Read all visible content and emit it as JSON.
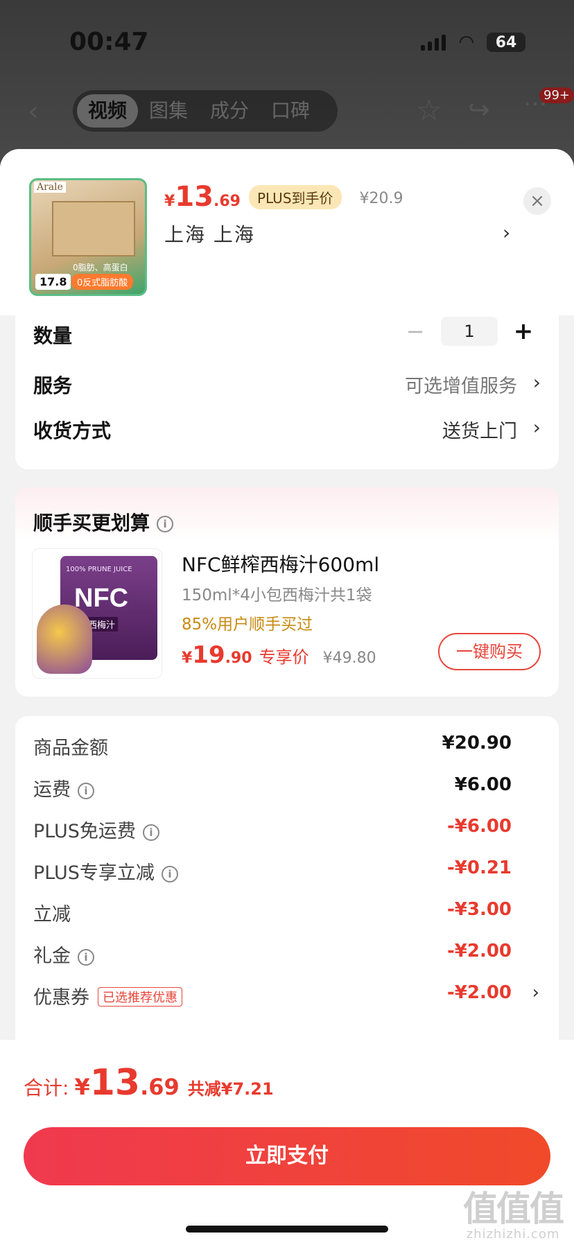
{
  "status_bar": {
    "time": "00:47",
    "battery": "64"
  },
  "nav": {
    "tabs": [
      {
        "label": "视频",
        "active": true
      },
      {
        "label": "图集",
        "active": false
      },
      {
        "label": "成分",
        "active": false
      },
      {
        "label": "口碑",
        "active": false
      }
    ],
    "badge": "99+"
  },
  "product": {
    "image_brand": "Arale",
    "image_price_tag": "17.8",
    "image_ribbon": "0反式脂肪酸",
    "image_subtag": "0脂肪、高蛋白",
    "price_symbol": "¥",
    "price_int": "13",
    "price_dec": ".69",
    "plus_tag": "PLUS到手价",
    "original_price": "¥20.9",
    "location": "上海  上海"
  },
  "options": {
    "quantity_label": "数量",
    "quantity_value": "1",
    "service_label": "服务",
    "service_value": "可选增值服务",
    "delivery_label": "收货方式",
    "delivery_value": "送货上门"
  },
  "addon": {
    "title": "顺手买更划算",
    "image_top_text": "100% PRUNE JUICE",
    "image_main_text": "NFC",
    "image_cn_text": "鲜榨西梅汁",
    "name": "NFC鲜榨西梅汁600ml",
    "spec": "150ml*4小包西梅汁共1袋",
    "rate": "85%用户顺手买过",
    "price_symbol": "¥",
    "price_int": "19",
    "price_dec": ".90",
    "price_label": "专享价",
    "original_price": "¥49.80",
    "buy_label": "一键购买"
  },
  "fees": [
    {
      "label": "商品金额",
      "value": "¥20.90",
      "info": false,
      "red": false
    },
    {
      "label": "运费",
      "value": "¥6.00",
      "info": true,
      "red": false
    },
    {
      "label": "PLUS免运费",
      "value": "-¥6.00",
      "info": true,
      "red": true
    },
    {
      "label": "PLUS专享立减",
      "value": "-¥0.21",
      "info": true,
      "red": true
    },
    {
      "label": "立减",
      "value": "-¥3.00",
      "info": false,
      "red": true
    },
    {
      "label": "礼金",
      "value": "-¥2.00",
      "info": true,
      "red": true
    },
    {
      "label": "优惠券",
      "value": "-¥2.00",
      "info": false,
      "red": true,
      "tag": "已选推荐优惠"
    }
  ],
  "footer": {
    "total_label": "合计:",
    "total_symbol": "¥",
    "total_int": "13",
    "total_dec": ".69",
    "saved": "共减¥7.21",
    "pay_label": "立即支付"
  },
  "watermark": {
    "logo": "值值值",
    "text": "zhizhizhi.com"
  },
  "colors": {
    "accent_red": "#e83a2e",
    "plus_gold": "#fbe7b6",
    "rate_orange": "#c98a12"
  }
}
